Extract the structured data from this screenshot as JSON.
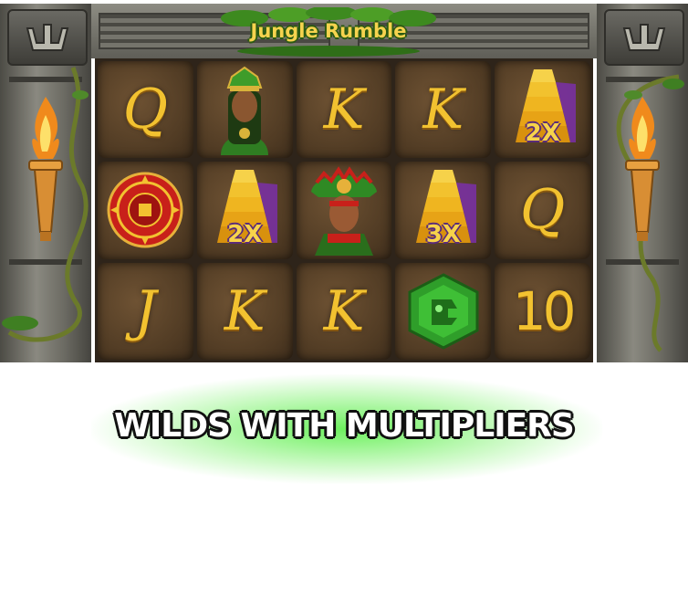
{
  "game": {
    "title": "Jungle Rumble",
    "caption": "WILDS WITH MULTIPLIERS"
  },
  "reels": {
    "row1": [
      {
        "symbol": "Q"
      },
      {
        "symbol": "priestess",
        "icon": "priestess-icon"
      },
      {
        "symbol": "K"
      },
      {
        "symbol": "K"
      },
      {
        "symbol": "pyramid-wild",
        "icon": "pyramid-wild-icon",
        "multiplier": "2X"
      }
    ],
    "row2": [
      {
        "symbol": "sun-stone",
        "icon": "sun-stone-icon"
      },
      {
        "symbol": "pyramid-wild",
        "icon": "pyramid-wild-icon",
        "multiplier": "2X"
      },
      {
        "symbol": "chief",
        "icon": "chief-icon"
      },
      {
        "symbol": "pyramid-wild",
        "icon": "pyramid-wild-icon",
        "multiplier": "3X"
      },
      {
        "symbol": "Q"
      }
    ],
    "row3": [
      {
        "symbol": "J"
      },
      {
        "symbol": "K"
      },
      {
        "symbol": "K"
      },
      {
        "symbol": "jade-idol",
        "icon": "jade-idol-icon"
      },
      {
        "symbol": "10"
      }
    ]
  },
  "colors": {
    "letter_gold": "#f2c230",
    "glow_green": "#3ceb28",
    "cell_brown": "#5a4229"
  }
}
